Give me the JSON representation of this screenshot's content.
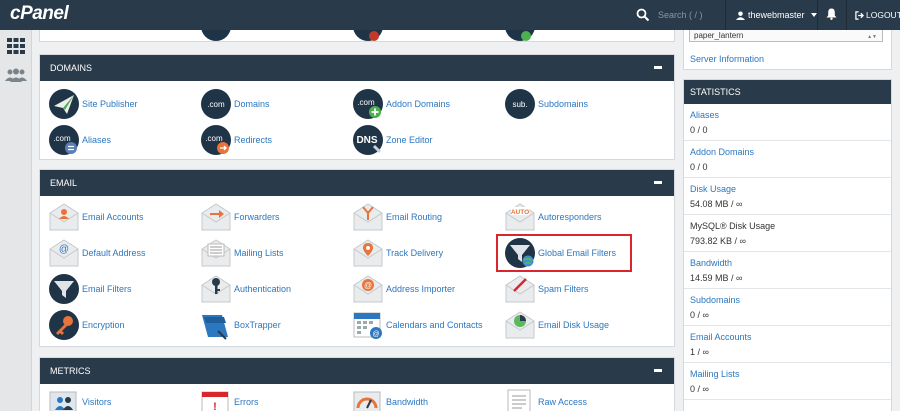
{
  "app": {
    "logo": "cPanel"
  },
  "search": {
    "placeholder": "Search ( / )"
  },
  "user": {
    "name": "thewebmaster"
  },
  "logout_label": "LOGOUT",
  "theme": {
    "selected": "paper_lantern"
  },
  "server_info": "Server Information",
  "groups": {
    "domains": {
      "title": "DOMAINS",
      "items": [
        "Site Publisher",
        "Domains",
        "Addon Domains",
        "Subdomains",
        "Aliases",
        "Redirects",
        "Zone Editor"
      ]
    },
    "email": {
      "title": "EMAIL",
      "items": [
        "Email Accounts",
        "Forwarders",
        "Email Routing",
        "Autoresponders",
        "Default Address",
        "Mailing Lists",
        "Track Delivery",
        "Global Email Filters",
        "Email Filters",
        "Authentication",
        "Address Importer",
        "Spam Filters",
        "Encryption",
        "BoxTrapper",
        "Calendars and Contacts",
        "Email Disk Usage"
      ]
    },
    "metrics": {
      "title": "METRICS",
      "items": [
        "Visitors",
        "Errors",
        "Bandwidth",
        "Raw Access"
      ]
    }
  },
  "statistics": {
    "title": "STATISTICS",
    "rows": [
      {
        "label": "Aliases",
        "value": "0 / 0"
      },
      {
        "label": "Addon Domains",
        "value": "0 / 0"
      },
      {
        "label": "Disk Usage",
        "value": "54.08 MB / ∞"
      },
      {
        "label": "MySQL® Disk Usage",
        "value": "793.82 KB / ∞"
      },
      {
        "label": "Bandwidth",
        "value": "14.59 MB / ∞"
      },
      {
        "label": "Subdomains",
        "value": "0 / ∞"
      },
      {
        "label": "Email Accounts",
        "value": "1 / ∞"
      },
      {
        "label": "Mailing Lists",
        "value": "0 / ∞"
      }
    ]
  },
  "colors": {
    "header": "#293a4a",
    "link": "#2b77c0",
    "highlight": "#d9262c"
  }
}
